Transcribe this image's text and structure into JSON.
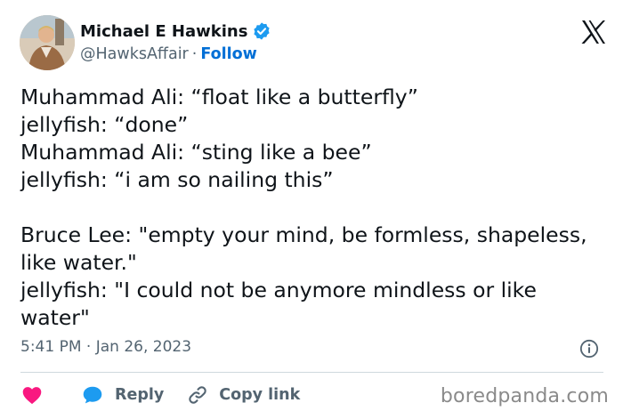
{
  "author": {
    "name": "Michael E Hawkins",
    "handle": "@HawksAffair",
    "separator": "·",
    "follow_label": "Follow"
  },
  "tweet": {
    "text": "Muhammad Ali: “float like a butterfly”\njellyfish: “done”\nMuhammad Ali: “sting like a bee”\njellyfish: “i am so nailing this”\n\nBruce Lee: \"empty your mind, be formless, shapeless, like water.\"\njellyfish: \"I could not be anymore mindless or like water\"",
    "timestamp": "5:41 PM · Jan 26, 2023"
  },
  "actions": {
    "reply_label": "Reply",
    "copy_label": "Copy link"
  },
  "watermark": "boredpanda.com",
  "colors": {
    "link_blue": "#006fd6",
    "heart_pink": "#f91880",
    "verified_blue": "#1d9bf0",
    "muted_text": "#536471"
  },
  "icons": {
    "platform": "x-logo-icon",
    "verified": "verified-badge-icon",
    "like": "heart-icon",
    "reply": "speech-bubble-icon",
    "copy": "link-icon",
    "info": "info-icon"
  }
}
